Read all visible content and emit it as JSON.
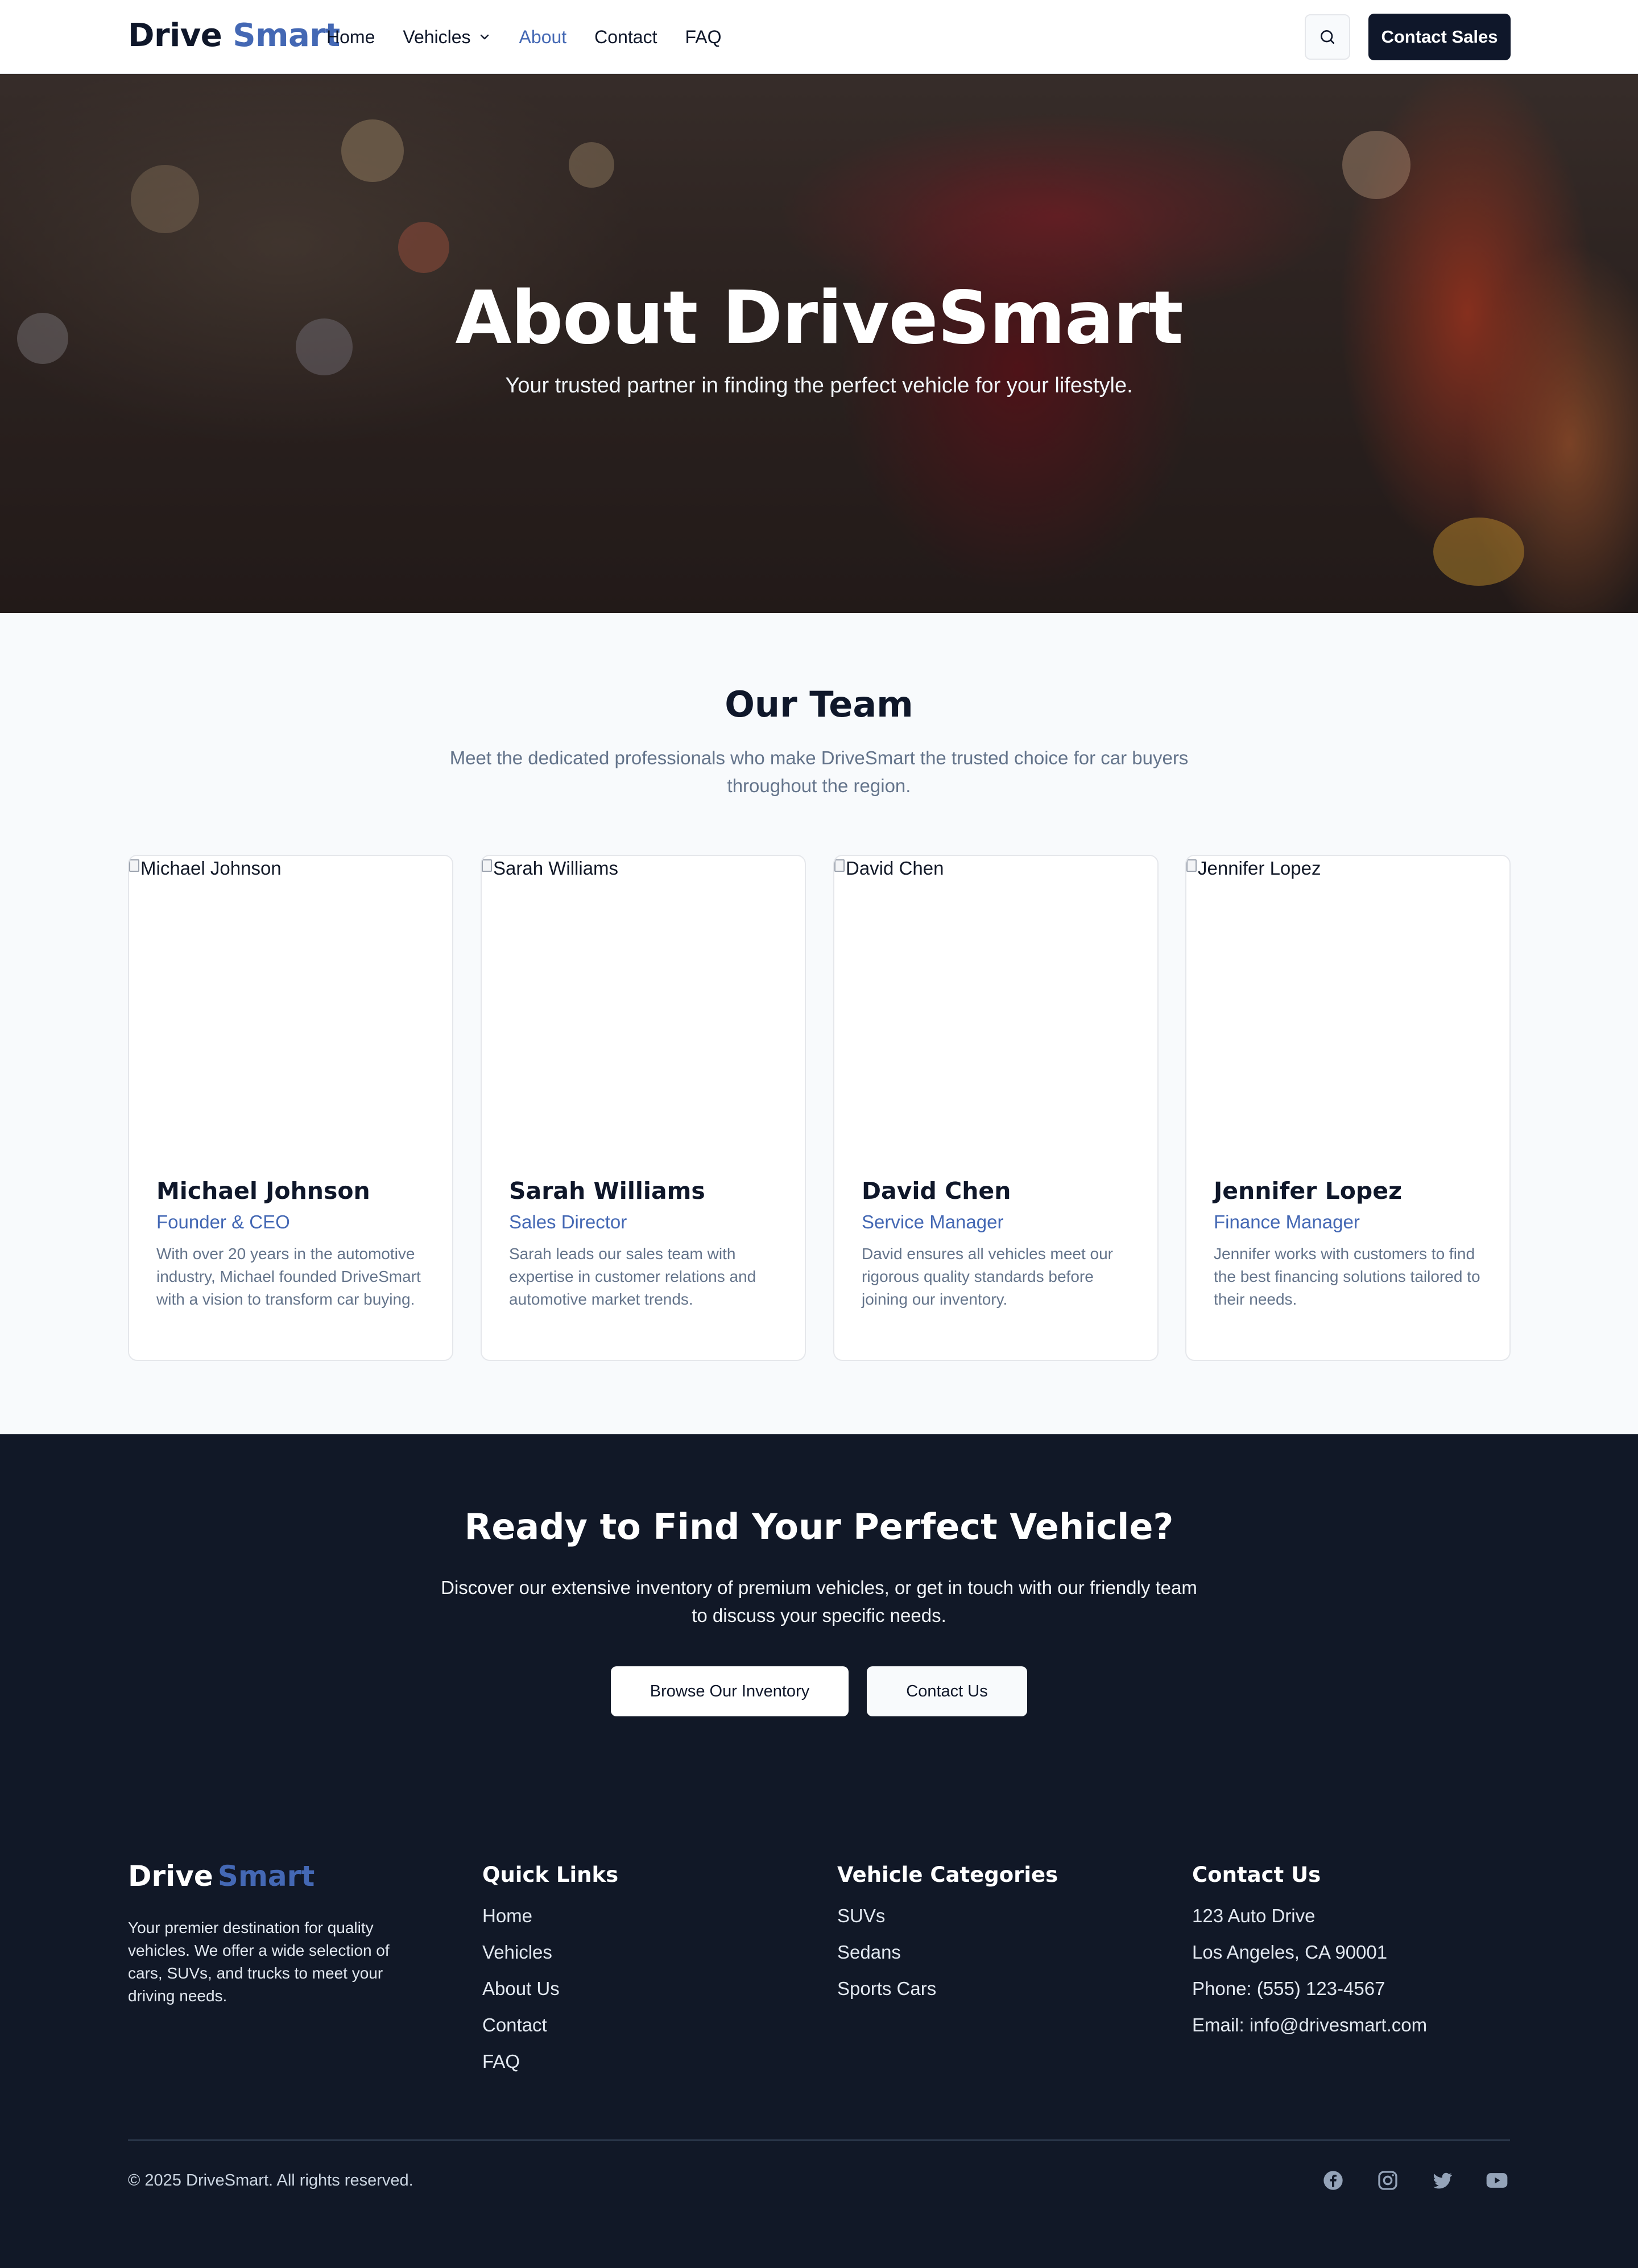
{
  "brand": {
    "part1": "Drive",
    "part2": "Smart"
  },
  "nav": {
    "links": [
      "Home",
      "Vehicles",
      "About",
      "Contact",
      "FAQ"
    ],
    "active": "About",
    "search_icon": "search-icon",
    "cta": "Contact Sales"
  },
  "hero": {
    "title": "About DriveSmart",
    "subtitle": "Your trusted partner in finding the perfect vehicle for your lifestyle."
  },
  "team": {
    "title": "Our Team",
    "subtitle": "Meet the dedicated professionals who make DriveSmart the trusted choice for car buyers throughout the region.",
    "members": [
      {
        "name": "Michael Johnson",
        "alt": "Michael Johnson",
        "role": "Founder & CEO",
        "bio": "With over 20 years in the automotive industry, Michael founded DriveSmart with a vision to transform car buying."
      },
      {
        "name": "Sarah Williams",
        "alt": "Sarah Williams",
        "role": "Sales Director",
        "bio": "Sarah leads our sales team with expertise in customer relations and automotive market trends."
      },
      {
        "name": "David Chen",
        "alt": "David Chen",
        "role": "Service Manager",
        "bio": "David ensures all vehicles meet our rigorous quality standards before joining our inventory."
      },
      {
        "name": "Jennifer Lopez",
        "alt": "Jennifer Lopez",
        "role": "Finance Manager",
        "bio": "Jennifer works with customers to find the best financing solutions tailored to their needs."
      }
    ]
  },
  "cta": {
    "title": "Ready to Find Your Perfect Vehicle?",
    "text": "Discover our extensive inventory of premium vehicles, or get in touch with our friendly team to discuss your specific needs.",
    "primary": "Browse Our Inventory",
    "secondary": "Contact Us"
  },
  "footer": {
    "description": "Your premier destination for quality vehicles. We offer a wide selection of cars, SUVs, and trucks to meet your driving needs.",
    "quick_links": {
      "title": "Quick Links",
      "items": [
        "Home",
        "Vehicles",
        "About Us",
        "Contact",
        "FAQ"
      ]
    },
    "categories": {
      "title": "Vehicle Categories",
      "items": [
        "SUVs",
        "Sedans",
        "Sports Cars"
      ]
    },
    "contact": {
      "title": "Contact Us",
      "items": [
        "123 Auto Drive",
        "Los Angeles, CA 90001",
        "Phone: (555) 123-4567",
        "Email: info@drivesmart.com"
      ]
    },
    "copyright": "© 2025 DriveSmart. All rights reserved.",
    "social_icons": [
      "facebook-icon",
      "instagram-icon",
      "twitter-icon",
      "youtube-icon"
    ]
  },
  "colors": {
    "accent": "#4468b4",
    "dark": "#0f172a",
    "footer_bg": "#111827",
    "muted": "#64748b"
  }
}
